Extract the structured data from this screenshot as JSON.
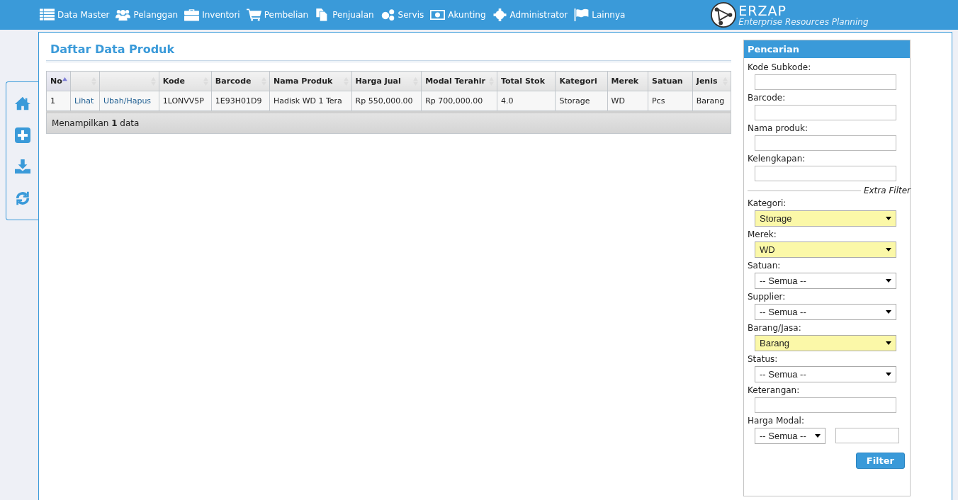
{
  "nav": {
    "items": [
      {
        "label": "Data Master"
      },
      {
        "label": "Pelanggan"
      },
      {
        "label": "Inventori"
      },
      {
        "label": "Pembelian"
      },
      {
        "label": "Penjualan"
      },
      {
        "label": "Servis"
      },
      {
        "label": "Akunting"
      },
      {
        "label": "Administrator"
      },
      {
        "label": "Lainnya"
      }
    ],
    "logo": {
      "name": "ERZAP",
      "tagline": "Enterprise Resources Planning"
    }
  },
  "page_title": "Daftar Data Produk",
  "table": {
    "columns": [
      {
        "label": "No",
        "sortable": true,
        "sorted": true
      },
      {
        "sortable": true,
        "sorted": false
      },
      {
        "sortable": true,
        "sorted": false
      },
      {
        "label": "Kode",
        "sortable": true,
        "sorted": false
      },
      {
        "label": "Barcode",
        "sortable": true,
        "sorted": false
      },
      {
        "label": "Nama Produk",
        "sortable": true,
        "sorted": false
      },
      {
        "label": "Harga Jual",
        "sortable": true,
        "sorted": false
      },
      {
        "label": "Modal Terahir",
        "sortable": true,
        "sorted": false
      },
      {
        "label": "Total Stok",
        "sortable": false,
        "sorted": false
      },
      {
        "label": "Kategori",
        "sortable": false,
        "sorted": false
      },
      {
        "label": "Merek",
        "sortable": false,
        "sorted": false
      },
      {
        "label": "Satuan",
        "sortable": false,
        "sorted": false
      },
      {
        "label": "Jenis",
        "sortable": true,
        "sorted": false
      }
    ],
    "rows": [
      {
        "cells": [
          {
            "kind": "text",
            "text": "1"
          },
          {
            "kind": "link",
            "text": "Lihat"
          },
          {
            "kind": "link",
            "text": "Ubah/Hapus"
          },
          {
            "kind": "text",
            "text": "1LONVV5P"
          },
          {
            "kind": "text",
            "text": "1E93H01D9"
          },
          {
            "kind": "text",
            "text": "Hadisk WD 1 Tera"
          },
          {
            "kind": "text",
            "text": "Rp 550,000.00"
          },
          {
            "kind": "text",
            "text": "Rp 700,000.00"
          },
          {
            "kind": "text",
            "text": "4.0"
          },
          {
            "kind": "text",
            "text": "Storage"
          },
          {
            "kind": "text",
            "text": "WD"
          },
          {
            "kind": "text",
            "text": "Pcs"
          },
          {
            "kind": "text",
            "text": "Barang"
          }
        ]
      }
    ],
    "footer": "Menampilkan **1** data"
  },
  "filter": {
    "title": "Pencarian",
    "button": "Filter",
    "fields": [
      {
        "kind": "text",
        "label": "Kode Subkode:"
      },
      {
        "kind": "text",
        "label": "Barcode:"
      },
      {
        "kind": "text",
        "label": "Nama produk:"
      },
      {
        "kind": "text",
        "label": "Kelengkapan:"
      },
      {
        "kind": "divider",
        "label": "Extra Filter"
      },
      {
        "kind": "select",
        "label": "Kategori:",
        "value": "Storage",
        "highlighted": true
      },
      {
        "kind": "select",
        "label": "Merek:",
        "value": "WD",
        "highlighted": true
      },
      {
        "kind": "select",
        "label": "Satuan:",
        "value": "-- Semua --",
        "highlighted": false
      },
      {
        "kind": "select",
        "label": "Supplier:",
        "value": "-- Semua --",
        "highlighted": false
      },
      {
        "kind": "select",
        "label": "Barang/Jasa:",
        "value": "Barang",
        "highlighted": true
      },
      {
        "kind": "select",
        "label": "Status:",
        "value": "-- Semua --",
        "highlighted": false
      },
      {
        "kind": "text",
        "label": "Keterangan:"
      },
      {
        "kind": "select_text",
        "label": "Harga Modal:",
        "value": "-- Semua --",
        "highlighted": false
      }
    ]
  }
}
